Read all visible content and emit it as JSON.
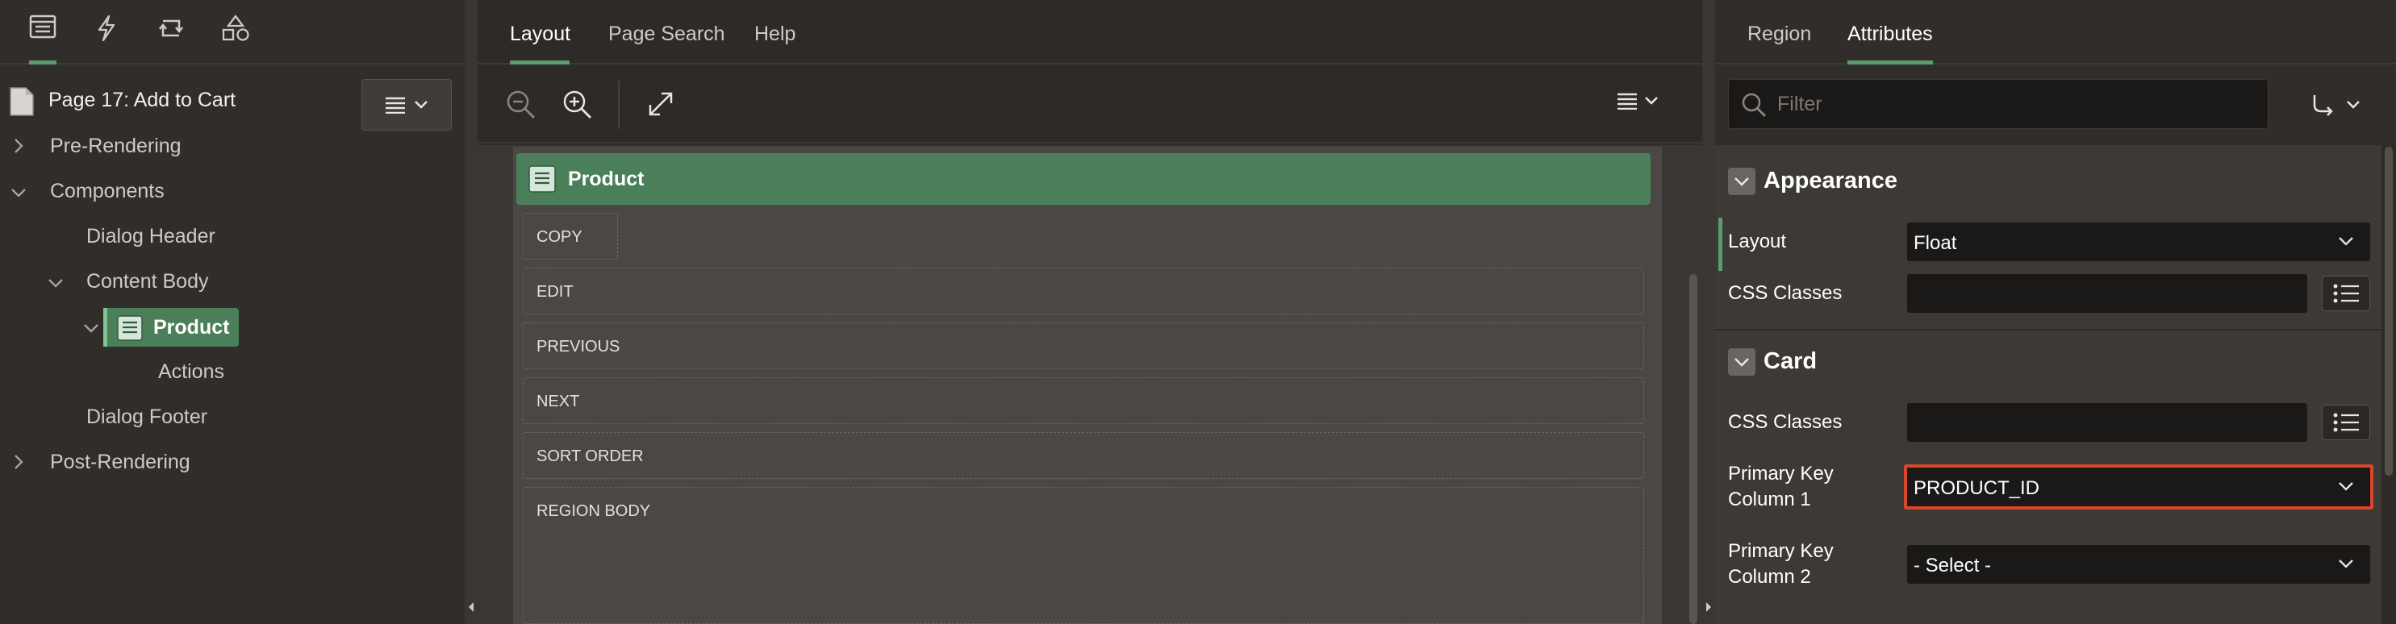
{
  "left_panel": {
    "tabs": [
      {
        "name": "rendering-tree-icon",
        "active": true
      },
      {
        "name": "dynamic-actions-icon",
        "active": false
      },
      {
        "name": "processing-icon",
        "active": false
      },
      {
        "name": "shared-components-icon",
        "active": false
      }
    ],
    "page_title": "Page 17: Add to Cart",
    "tree": {
      "pre_rendering": "Pre-Rendering",
      "components": "Components",
      "dialog_header": "Dialog Header",
      "content_body": "Content Body",
      "product": "Product",
      "actions": "Actions",
      "dialog_footer": "Dialog Footer",
      "post_rendering": "Post-Rendering"
    }
  },
  "middle_panel": {
    "tabs": [
      "Layout",
      "Page Search",
      "Help"
    ],
    "active_tab": "Layout",
    "region_title": "Product",
    "slots": [
      "COPY",
      "EDIT",
      "PREVIOUS",
      "NEXT",
      "SORT ORDER",
      "REGION BODY"
    ]
  },
  "right_panel": {
    "tabs": [
      "Region",
      "Attributes"
    ],
    "active_tab": "Attributes",
    "filter_placeholder": "Filter",
    "groups": {
      "appearance": {
        "title": "Appearance",
        "layout_label": "Layout",
        "layout_value": "Float",
        "css_classes_label": "CSS Classes",
        "css_classes_value": ""
      },
      "card": {
        "title": "Card",
        "css_classes_label": "CSS Classes",
        "css_classes_value": "",
        "pk1_label_line1": "Primary Key",
        "pk1_label_line2": "Column 1",
        "pk1_value": "PRODUCT_ID",
        "pk2_label_line1": "Primary Key",
        "pk2_label_line2": "Column 2",
        "pk2_value": "- Select -"
      }
    }
  },
  "colors": {
    "accent_green": "#5a9e6f",
    "region_green": "#4a7f59",
    "highlight_red": "#d9452d"
  }
}
